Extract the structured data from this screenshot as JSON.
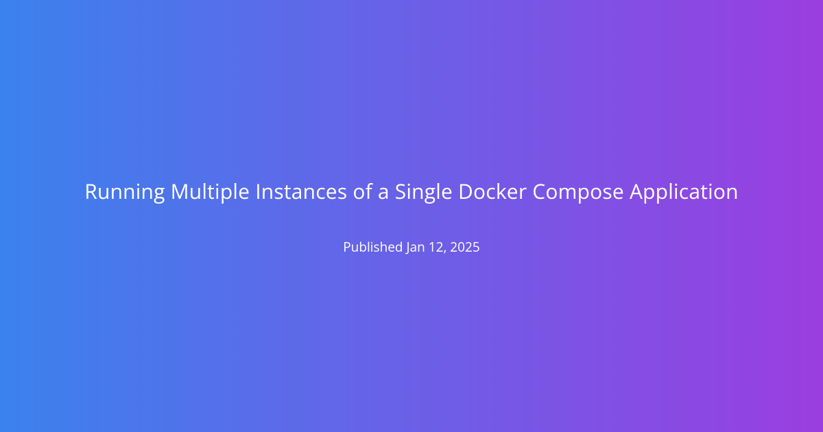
{
  "card": {
    "title": "Running Multiple Instances of a Single Docker Compose Application",
    "published": "Published Jan 12, 2025"
  }
}
